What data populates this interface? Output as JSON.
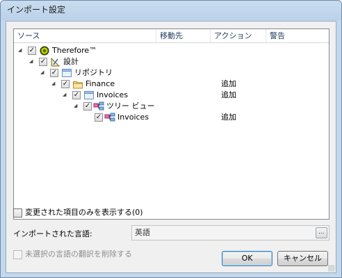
{
  "window": {
    "title": "インポート設定"
  },
  "tree": {
    "columns": [
      "ソース",
      "移動先",
      "アクション",
      "警告"
    ],
    "rows": [
      {
        "label": "Therefore™",
        "icon": "therefore-logo-icon",
        "action": ""
      },
      {
        "label": "設計",
        "icon": "design-icon",
        "action": ""
      },
      {
        "label": "リポジトリ",
        "icon": "repository-icon",
        "action": ""
      },
      {
        "label": "Finance",
        "icon": "folder-icon",
        "action": "追加"
      },
      {
        "label": "Invoices",
        "icon": "category-icon",
        "action": "追加"
      },
      {
        "label": "ツリー ビュー",
        "icon": "treeview-icon",
        "action": ""
      },
      {
        "label": "Invoices",
        "icon": "treeview-icon",
        "action": "追加"
      }
    ]
  },
  "show_changed": {
    "label": "変更された項目のみを表示する(0)"
  },
  "language": {
    "label": "インポートされた言語:",
    "value": "英語",
    "button": "..."
  },
  "delete_unselected": {
    "label": "未選択の言語の翻訳を削除する"
  },
  "buttons": {
    "ok": "OK",
    "cancel": "キャンセル"
  }
}
